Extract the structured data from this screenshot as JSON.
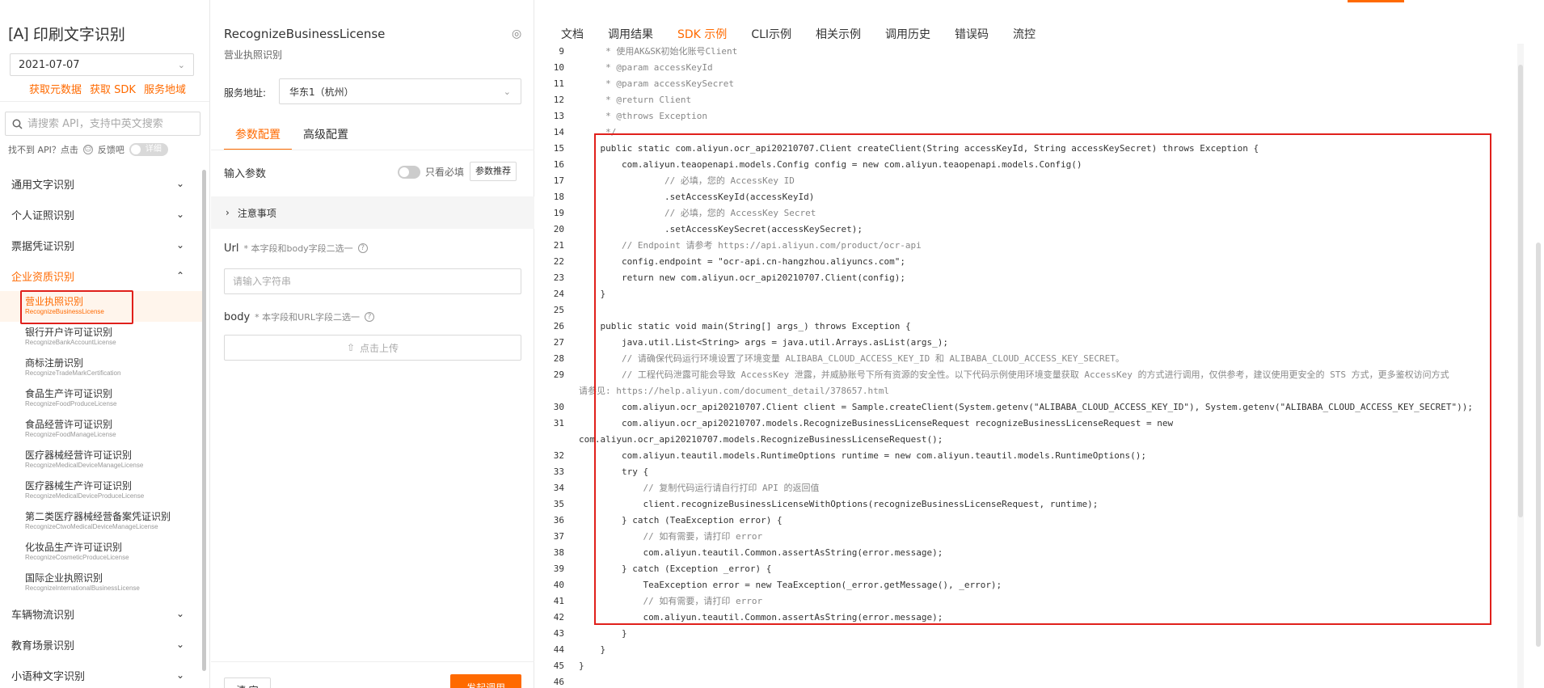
{
  "product": {
    "bracket": "[A]",
    "title": "印刷文字识别"
  },
  "version": "2021-07-07",
  "meta_links": [
    "获取元数据",
    "获取 SDK",
    "服务地域"
  ],
  "search": {
    "placeholder": "请搜索 API，支持中英文搜索"
  },
  "feedback": {
    "text": "找不到 API？点击",
    "link": "反馈吧",
    "toggle": "详细"
  },
  "menu": {
    "cats_before": [
      {
        "label": "通用文字识别"
      },
      {
        "label": "个人证照识别"
      },
      {
        "label": "票据凭证识别"
      }
    ],
    "open_cat": {
      "label": "企业资质识别"
    },
    "subs": [
      {
        "cn": "营业执照识别",
        "en": "RecognizeBusinessLicense"
      },
      {
        "cn": "银行开户许可证识别",
        "en": "RecognizeBankAccountLicense"
      },
      {
        "cn": "商标注册识别",
        "en": "RecognizeTradeMarkCertification"
      },
      {
        "cn": "食品生产许可证识别",
        "en": "RecognizeFoodProduceLicense"
      },
      {
        "cn": "食品经营许可证识别",
        "en": "RecognizeFoodManageLicense"
      },
      {
        "cn": "医疗器械经营许可证识别",
        "en": "RecognizeMedicalDeviceManageLicense"
      },
      {
        "cn": "医疗器械生产许可证识别",
        "en": "RecognizeMedicalDeviceProduceLicense"
      },
      {
        "cn": "第二类医疗器械经营备案凭证识别",
        "en": "RecognizeCtwoMedicalDeviceManageLicense"
      },
      {
        "cn": "化妆品生产许可证识别",
        "en": "RecognizeCosmeticProduceLicense"
      },
      {
        "cn": "国际企业执照识别",
        "en": "RecognizeInternationalBusinessLicense"
      }
    ],
    "cats_after": [
      {
        "label": "车辆物流识别"
      },
      {
        "label": "教育场景识别"
      },
      {
        "label": "小语种文字识别"
      }
    ]
  },
  "api": {
    "name": "RecognizeBusinessLicense",
    "desc": "营业执照识别",
    "endpoint_label": "服务地址:",
    "endpoint_value": "华东1（杭州）"
  },
  "param_tabs": [
    "参数配置",
    "高级配置"
  ],
  "params": {
    "title": "输入参数",
    "required_only": "只看必填",
    "recommend": "参数推荐",
    "notice": "注意事项",
    "url_label": "Url",
    "url_hint": "* 本字段和body字段二选一",
    "url_placeholder": "请输入字符串",
    "body_label": "body",
    "body_hint": "* 本字段和URL字段二选一",
    "upload": "点击上传",
    "clear": "清 空",
    "invoke": "发起调用"
  },
  "right_tabs": [
    {
      "label": "文档",
      "active": false
    },
    {
      "label": "调用结果",
      "active": false
    },
    {
      "label": "SDK 示例",
      "active": true
    },
    {
      "label": "CLI示例",
      "active": false
    },
    {
      "label": "相关示例",
      "active": false
    },
    {
      "label": "调用历史",
      "active": false
    },
    {
      "label": "错误码",
      "active": false
    },
    {
      "label": "流控",
      "active": false
    }
  ],
  "code": [
    {
      "n": "9",
      "t": "     * 使用AK&SK初始化账号Client",
      "c": true
    },
    {
      "n": "10",
      "t": "     * @param accessKeyId",
      "c": true
    },
    {
      "n": "11",
      "t": "     * @param accessKeySecret",
      "c": true
    },
    {
      "n": "12",
      "t": "     * @return Client",
      "c": true
    },
    {
      "n": "13",
      "t": "     * @throws Exception",
      "c": true
    },
    {
      "n": "14",
      "t": "     */",
      "c": true
    },
    {
      "n": "15",
      "t": "    public static com.aliyun.ocr_api20210707.Client createClient(String accessKeyId, String accessKeySecret) throws Exception {"
    },
    {
      "n": "16",
      "t": "        com.aliyun.teaopenapi.models.Config config = new com.aliyun.teaopenapi.models.Config()"
    },
    {
      "n": "17",
      "t": "                // 必填，您的 AccessKey ID",
      "c": true
    },
    {
      "n": "18",
      "t": "                .setAccessKeyId(accessKeyId)"
    },
    {
      "n": "19",
      "t": "                // 必填，您的 AccessKey Secret",
      "c": true
    },
    {
      "n": "20",
      "t": "                .setAccessKeySecret(accessKeySecret);"
    },
    {
      "n": "21",
      "t": "        // Endpoint 请参考 https://api.aliyun.com/product/ocr-api",
      "c": true
    },
    {
      "n": "22",
      "t": "        config.endpoint = \"ocr-api.cn-hangzhou.aliyuncs.com\";"
    },
    {
      "n": "23",
      "t": "        return new com.aliyun.ocr_api20210707.Client(config);"
    },
    {
      "n": "24",
      "t": "    }"
    },
    {
      "n": "25",
      "t": ""
    },
    {
      "n": "26",
      "t": "    public static void main(String[] args_) throws Exception {"
    },
    {
      "n": "27",
      "t": "        java.util.List<String> args = java.util.Arrays.asList(args_);"
    },
    {
      "n": "28",
      "t": "        // 请确保代码运行环境设置了环境变量 ALIBABA_CLOUD_ACCESS_KEY_ID 和 ALIBABA_CLOUD_ACCESS_KEY_SECRET。",
      "c": true
    },
    {
      "n": "29",
      "t": "        // 工程代码泄露可能会导致 AccessKey 泄露，并威胁账号下所有资源的安全性。以下代码示例使用环境变量获取 AccessKey 的方式进行调用，仅供参考，建议使用更安全的 STS 方式，更多鉴权访问方式\n请参见: https://help.aliyun.com/document_detail/378657.html",
      "c": true,
      "w": true
    },
    {
      "n": "30",
      "t": "        com.aliyun.ocr_api20210707.Client client = Sample.createClient(System.getenv(\"ALIBABA_CLOUD_ACCESS_KEY_ID\"), System.getenv(\"ALIBABA_CLOUD_ACCESS_KEY_SECRET\"));"
    },
    {
      "n": "31",
      "t": "        com.aliyun.ocr_api20210707.models.RecognizeBusinessLicenseRequest recognizeBusinessLicenseRequest = new\ncom.aliyun.ocr_api20210707.models.RecognizeBusinessLicenseRequest();",
      "w": true
    },
    {
      "n": "32",
      "t": "        com.aliyun.teautil.models.RuntimeOptions runtime = new com.aliyun.teautil.models.RuntimeOptions();"
    },
    {
      "n": "33",
      "t": "        try {"
    },
    {
      "n": "34",
      "t": "            // 复制代码运行请自行打印 API 的返回值",
      "c": true
    },
    {
      "n": "35",
      "t": "            client.recognizeBusinessLicenseWithOptions(recognizeBusinessLicenseRequest, runtime);"
    },
    {
      "n": "36",
      "t": "        } catch (TeaException error) {"
    },
    {
      "n": "37",
      "t": "            // 如有需要，请打印 error",
      "c": true
    },
    {
      "n": "38",
      "t": "            com.aliyun.teautil.Common.assertAsString(error.message);"
    },
    {
      "n": "39",
      "t": "        } catch (Exception _error) {"
    },
    {
      "n": "40",
      "t": "            TeaException error = new TeaException(_error.getMessage(), _error);"
    },
    {
      "n": "41",
      "t": "            // 如有需要，请打印 error",
      "c": true
    },
    {
      "n": "42",
      "t": "            com.aliyun.teautil.Common.assertAsString(error.message);"
    },
    {
      "n": "43",
      "t": "        }"
    },
    {
      "n": "44",
      "t": "    }"
    },
    {
      "n": "45",
      "t": "}"
    },
    {
      "n": "46",
      "t": ""
    }
  ],
  "colors": {
    "accent": "#ff6a00",
    "highlight": "#e0201b"
  }
}
